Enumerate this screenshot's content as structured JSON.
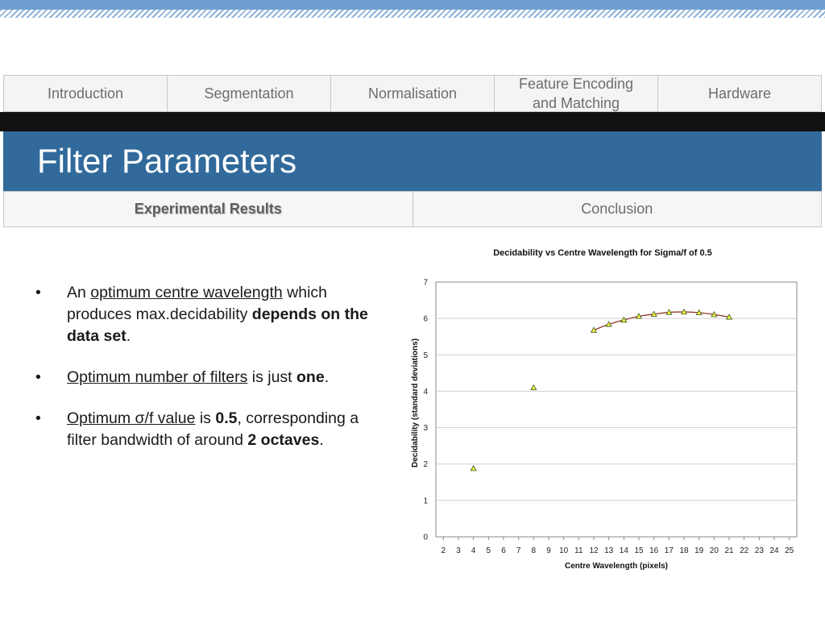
{
  "nav": {
    "tabs": [
      {
        "label": "Introduction"
      },
      {
        "label": "Segmentation"
      },
      {
        "label": "Normalisation"
      },
      {
        "label": "Feature Encoding\nand Matching"
      },
      {
        "label": "Hardware"
      }
    ]
  },
  "slide": {
    "title": "Filter Parameters"
  },
  "subnav": {
    "tabs": [
      {
        "label": "Experimental Results",
        "active": true
      },
      {
        "label": "Conclusion",
        "active": false
      }
    ]
  },
  "bullets": {
    "b1": {
      "p1": "An ",
      "p2": "optimum centre wavelength",
      "p3": " which produces max.decidability ",
      "p4": "depends on the data set",
      "p5": "."
    },
    "b2": {
      "p1": "Optimum number of filters",
      "p2": " is just ",
      "p3": "one",
      "p4": "."
    },
    "b3": {
      "p1": "Optimum σ/f value",
      "p2": " is ",
      "p3": "0.5",
      "p4": ", corresponding a filter bandwidth of around ",
      "p5": "2 octaves",
      "p6": "."
    }
  },
  "colors": {
    "title_band": "#316a9b",
    "curve": "#8b2a1a",
    "marker_fill": "#f2ef4a",
    "marker_stroke": "#3a5a1a"
  },
  "chart_data": {
    "type": "scatter",
    "title": "Decidability vs Centre Wavelength for Sigma/f of 0.5",
    "xlabel": "Centre Wavelength (pixels)",
    "ylabel": "Decidability (standard deviations)",
    "xlim": [
      1.5,
      25.5
    ],
    "ylim": [
      0,
      7
    ],
    "x_ticks": [
      2,
      3,
      4,
      5,
      6,
      7,
      8,
      9,
      10,
      11,
      12,
      13,
      14,
      15,
      16,
      17,
      18,
      19,
      20,
      21,
      22,
      23,
      24,
      25
    ],
    "y_ticks": [
      0,
      1,
      2,
      3,
      4,
      5,
      6,
      7
    ],
    "grid": "horizontal",
    "legend": "none",
    "marker": "triangle",
    "points": [
      {
        "x": 4,
        "y": 1.88
      },
      {
        "x": 8,
        "y": 4.1
      },
      {
        "x": 12,
        "y": 5.68
      },
      {
        "x": 13,
        "y": 5.84
      },
      {
        "x": 14,
        "y": 5.96
      },
      {
        "x": 15,
        "y": 6.06
      },
      {
        "x": 16,
        "y": 6.12
      },
      {
        "x": 17,
        "y": 6.17
      },
      {
        "x": 18,
        "y": 6.18
      },
      {
        "x": 19,
        "y": 6.16
      },
      {
        "x": 20,
        "y": 6.11
      },
      {
        "x": 21,
        "y": 6.04
      }
    ],
    "trend_line_x_range": [
      12,
      21
    ]
  }
}
